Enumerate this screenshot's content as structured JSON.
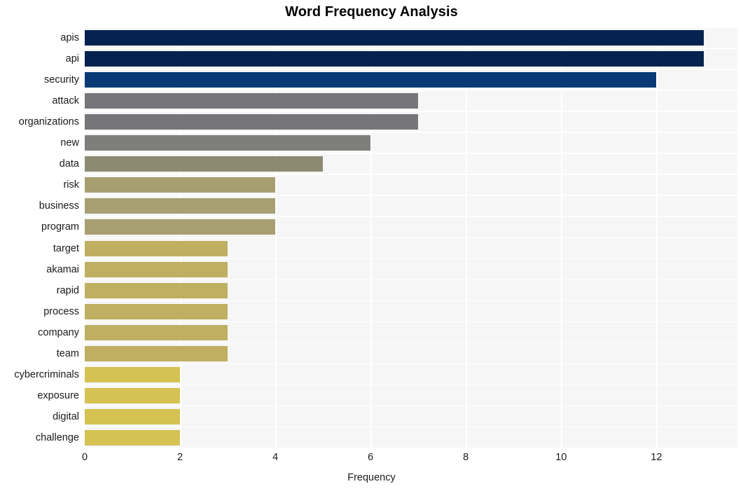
{
  "chart_data": {
    "type": "bar",
    "orientation": "horizontal",
    "title": "Word Frequency Analysis",
    "xlabel": "Frequency",
    "ylabel": "",
    "categories": [
      "apis",
      "api",
      "security",
      "attack",
      "organizations",
      "new",
      "data",
      "risk",
      "business",
      "program",
      "target",
      "akamai",
      "rapid",
      "process",
      "company",
      "team",
      "cybercriminals",
      "exposure",
      "digital",
      "challenge"
    ],
    "values": [
      13,
      13,
      12,
      7,
      7,
      6,
      5,
      4,
      4,
      4,
      3,
      3,
      3,
      3,
      3,
      3,
      2,
      2,
      2,
      2
    ],
    "bar_colors": [
      "#05234e",
      "#05234e",
      "#0a3a76",
      "#75757a",
      "#75757a",
      "#7e7e7c",
      "#8e8a72",
      "#a79f72",
      "#a79f72",
      "#a79f72",
      "#bfaf61",
      "#bfaf61",
      "#bfaf61",
      "#bfaf61",
      "#bfaf61",
      "#bfaf61",
      "#d4c252",
      "#d4c252",
      "#d4c252",
      "#d4c252"
    ],
    "xticks": [
      0,
      2,
      4,
      6,
      8,
      10,
      12
    ],
    "xtick_labels": [
      "0",
      "2",
      "4",
      "6",
      "8",
      "10",
      "12"
    ],
    "xlim": [
      0,
      13.7
    ],
    "grid": true,
    "grid_color": "#ffffff",
    "plot_background": "#f6f6f7",
    "figure_background": "#ffffff",
    "legend": null
  }
}
